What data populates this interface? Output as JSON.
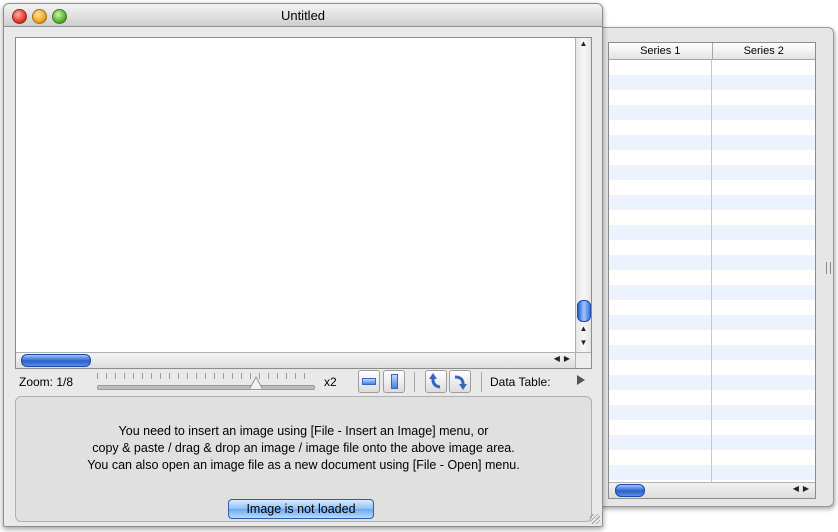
{
  "window": {
    "title": "Untitled"
  },
  "toolbar": {
    "zoom_label": "Zoom: 1/8",
    "zoom_max_label": "x2",
    "data_table_label": "Data Table:"
  },
  "message": {
    "line1": "You need to insert an image using [File - Insert an Image] menu, or",
    "line2": "copy & paste / drag & drop an image / image file onto the above image area.",
    "line3": "You can also open an image file as a new document using [File - Open] menu."
  },
  "status_button": {
    "label": "Image is not loaded"
  },
  "data_table": {
    "columns": [
      "Series 1",
      "Series 2"
    ]
  },
  "icons": {
    "close": "close-icon",
    "minimize": "minimize-icon",
    "zoom": "zoom-icon",
    "fit_width": "fit-width-icon",
    "fit_height": "fit-height-icon",
    "rotate_left": "rotate-left-icon",
    "rotate_right": "rotate-right-icon",
    "disclosure": "disclosure-triangle-icon"
  }
}
